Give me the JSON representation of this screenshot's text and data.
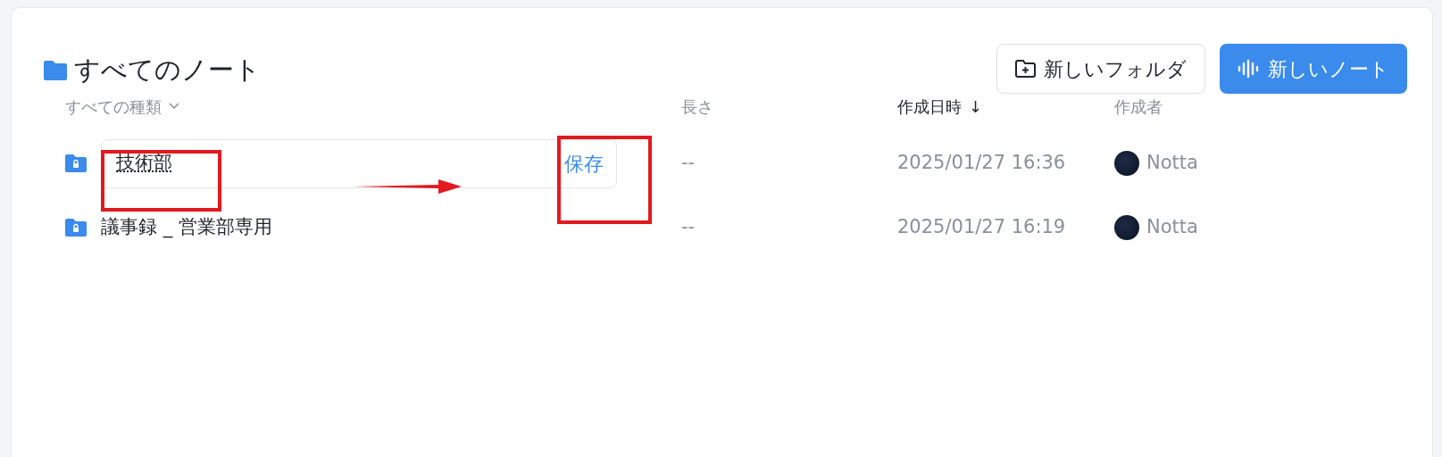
{
  "header": {
    "title": "すべてのノート",
    "buttons": [
      {
        "label": "新しいフォルダ",
        "kind": "outline"
      },
      {
        "label": "新しいノート",
        "kind": "primary"
      }
    ]
  },
  "columns": [
    {
      "label": "すべての種類",
      "kind": "dropdown",
      "sorted": false
    },
    {
      "label": "長さ",
      "kind": "plain",
      "sorted": false
    },
    {
      "label": "作成日時",
      "kind": "plain",
      "sorted": true,
      "sort_arrow": "↓"
    },
    {
      "label": "作成者",
      "kind": "plain",
      "sorted": false
    }
  ],
  "rows": [
    {
      "name": "技術部",
      "editing": true,
      "save_label": "保存",
      "length": "--",
      "created": "2025/01/27 16:36",
      "author": "Notta"
    },
    {
      "name": "議事録 _ 営業部専用",
      "editing": false,
      "length": "--",
      "created": "2025/01/27 16:19",
      "author": "Notta"
    }
  ],
  "annotations": [
    {
      "kind": "box"
    },
    {
      "kind": "box"
    },
    {
      "kind": "arrow"
    }
  ]
}
